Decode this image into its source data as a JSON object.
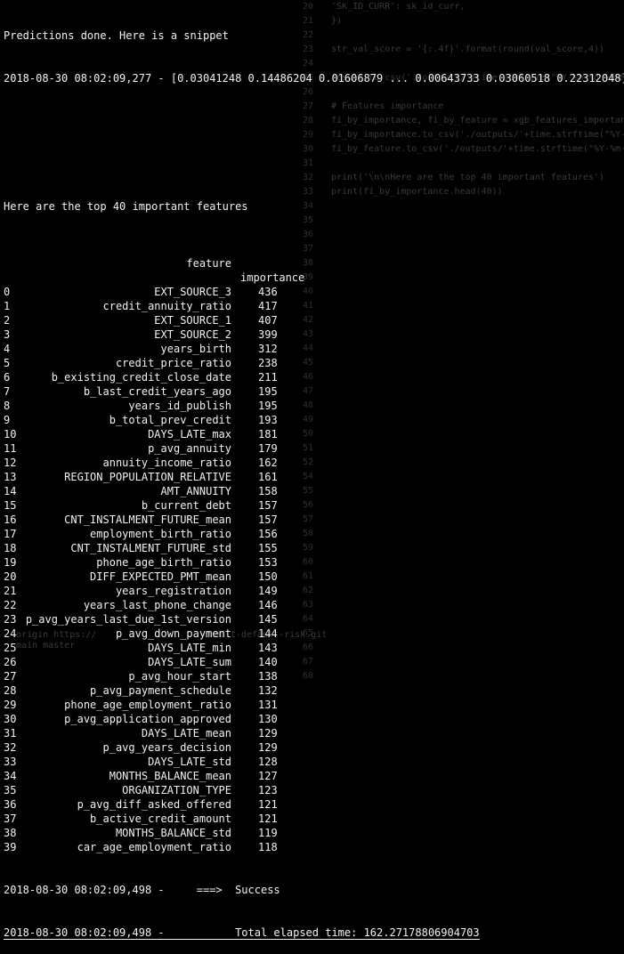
{
  "terminal": {
    "line1": "Predictions done. Here is a snippet",
    "line2": "2018-08-30 08:02:09,277 - [0.03041248 0.14486204 0.01606879 ... 0.00643733 0.03060518 0.22312048]",
    "heading": "Here are the top 40 important features",
    "col_feature": "feature",
    "col_importance": "importance",
    "rows": [
      {
        "i": "0",
        "f": "EXT_SOURCE_3",
        "v": "436"
      },
      {
        "i": "1",
        "f": "credit_annuity_ratio",
        "v": "417"
      },
      {
        "i": "2",
        "f": "EXT_SOURCE_1",
        "v": "407"
      },
      {
        "i": "3",
        "f": "EXT_SOURCE_2",
        "v": "399"
      },
      {
        "i": "4",
        "f": "years_birth",
        "v": "312"
      },
      {
        "i": "5",
        "f": "credit_price_ratio",
        "v": "238"
      },
      {
        "i": "6",
        "f": "b_existing_credit_close_date",
        "v": "211"
      },
      {
        "i": "7",
        "f": "b_last_credit_years_ago",
        "v": "195"
      },
      {
        "i": "8",
        "f": "years_id_publish",
        "v": "195"
      },
      {
        "i": "9",
        "f": "b_total_prev_credit",
        "v": "193"
      },
      {
        "i": "10",
        "f": "DAYS_LATE_max",
        "v": "181"
      },
      {
        "i": "11",
        "f": "p_avg_annuity",
        "v": "179"
      },
      {
        "i": "12",
        "f": "annuity_income_ratio",
        "v": "162"
      },
      {
        "i": "13",
        "f": "REGION_POPULATION_RELATIVE",
        "v": "161"
      },
      {
        "i": "14",
        "f": "AMT_ANNUITY",
        "v": "158"
      },
      {
        "i": "15",
        "f": "b_current_debt",
        "v": "157"
      },
      {
        "i": "16",
        "f": "CNT_INSTALMENT_FUTURE_mean",
        "v": "157"
      },
      {
        "i": "17",
        "f": "employment_birth_ratio",
        "v": "156"
      },
      {
        "i": "18",
        "f": "CNT_INSTALMENT_FUTURE_std",
        "v": "155"
      },
      {
        "i": "19",
        "f": "phone_age_birth_ratio",
        "v": "153"
      },
      {
        "i": "20",
        "f": "DIFF_EXPECTED_PMT_mean",
        "v": "150"
      },
      {
        "i": "21",
        "f": "years_registration",
        "v": "149"
      },
      {
        "i": "22",
        "f": "years_last_phone_change",
        "v": "146"
      },
      {
        "i": "23",
        "f": "p_avg_years_last_due_1st_version",
        "v": "145"
      },
      {
        "i": "24",
        "f": "p_avg_down_payment",
        "v": "144"
      },
      {
        "i": "25",
        "f": "DAYS_LATE_min",
        "v": "143"
      },
      {
        "i": "26",
        "f": "DAYS_LATE_sum",
        "v": "140"
      },
      {
        "i": "27",
        "f": "p_avg_hour_start",
        "v": "138"
      },
      {
        "i": "28",
        "f": "p_avg_payment_schedule",
        "v": "132"
      },
      {
        "i": "29",
        "f": "phone_age_employment_ratio",
        "v": "131"
      },
      {
        "i": "30",
        "f": "p_avg_application_approved",
        "v": "130"
      },
      {
        "i": "31",
        "f": "DAYS_LATE_mean",
        "v": "129"
      },
      {
        "i": "32",
        "f": "p_avg_years_decision",
        "v": "129"
      },
      {
        "i": "33",
        "f": "DAYS_LATE_std",
        "v": "128"
      },
      {
        "i": "34",
        "f": "MONTHS_BALANCE_mean",
        "v": "127"
      },
      {
        "i": "35",
        "f": "ORGANIZATION_TYPE",
        "v": "123"
      },
      {
        "i": "36",
        "f": "p_avg_diff_asked_offered",
        "v": "121"
      },
      {
        "i": "37",
        "f": "b_active_credit_amount",
        "v": "121"
      },
      {
        "i": "38",
        "f": "MONTHS_BALANCE_std",
        "v": "119"
      },
      {
        "i": "39",
        "f": "car_age_employment_ratio",
        "v": "118"
      }
    ],
    "success_line": "2018-08-30 08:02:09,498 -     ===>  Success",
    "elapsed_line": "2018-08-30 08:02:09,498 -           Total elapsed time: 162.27178806904703"
  },
  "background_code": {
    "gutter": [
      "20",
      "21",
      "22",
      "23",
      "24",
      "25",
      "26",
      "27",
      "28",
      "29",
      "30",
      "31",
      "32",
      "33",
      "34",
      "35",
      "36",
      "37",
      "38",
      "39",
      "40",
      "41",
      "42",
      "43",
      "44",
      "45",
      "46",
      "47",
      "48",
      "49",
      "50",
      "51",
      "52",
      "54",
      "55",
      "56",
      "57",
      "58",
      "59",
      "60",
      "61",
      "62",
      "63",
      "64",
      "65",
      "66",
      "67",
      "68"
    ],
    "lines": [
      "'SK_ID_CURR': sk_id_curr,",
      "})",
      "",
      "str_val_score = '{:.4f}'.format(round(val_score,4))",
      "",
      "result.to_csv('./outputs/'+time.strftime(\"%Y-%m-%d_%H%M",
      "",
      "# Features importance",
      "fi_by_importance, fi_by_feature = xgb_features_importance",
      "fi_by_importance.to_csv('./outputs/'+time.strftime(\"%Y-",
      "fi_by_feature.to_csv('./outputs/'+time.strftime(\"%Y-%m-",
      "",
      "print('\\n\\nHere are the top 40 important features')",
      "print(fi_by_importance.head(40))"
    ],
    "git_line1": "   origin https://                    credit-default-risk.git",
    "git_line2": "   main master"
  }
}
